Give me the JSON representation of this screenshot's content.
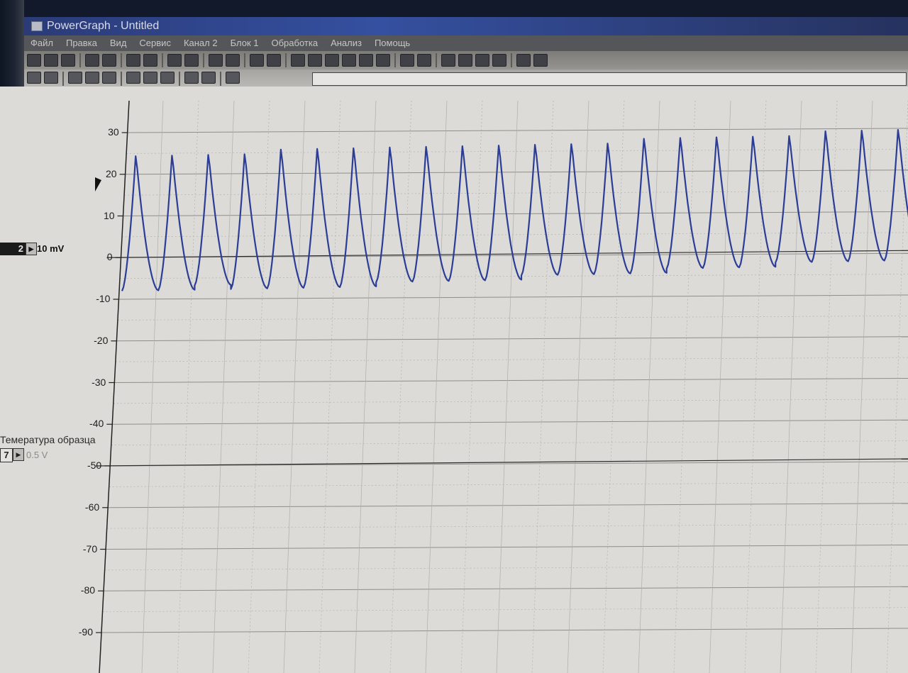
{
  "window": {
    "title": "PowerGraph - Untitled"
  },
  "menu": [
    "Файл",
    "Правка",
    "Вид",
    "Сервис",
    "Канал 2",
    "Блок 1",
    "Обработка",
    "Анализ",
    "Помощь"
  ],
  "toolbar1_icons": [
    "new-icon",
    "open-icon",
    "open-folder-icon",
    "save-icon",
    "save-as-icon",
    "print-icon",
    "print-preview-icon",
    "copy-block-icon",
    "paste-block-icon",
    "export-icon",
    "import-icon",
    "properties-icon",
    "record-icon",
    "channels-icon",
    "block-icon",
    "ruler-icon",
    "edit-data-icon",
    "merge-icon",
    "cut-block-icon",
    "function-icon",
    "table-icon",
    "zoom-analysis-icon",
    "histogram-icon",
    "spectrum-icon",
    "filter-icon",
    "help-icon",
    "web-icon"
  ],
  "toolbar2_icons": [
    "channel-select-icon",
    "dropdown-icon",
    "scale-icon",
    "zoom-out-icon",
    "zoom-in-icon",
    "vertical-fit-icon",
    "horizontal-fit-icon",
    "grid-icon",
    "autoscale-icon",
    "auto-range-icon",
    "marker-icon"
  ],
  "channels": {
    "ch2": {
      "number": "2",
      "range": "10 mV"
    },
    "ch7": {
      "name": "Темература образца",
      "number": "7",
      "range": "0.5 V"
    }
  },
  "y_axis_ticks": [
    "30",
    "20",
    "10",
    "0",
    "-10",
    "-20",
    "-30",
    "-40",
    "-50",
    "-60",
    "-70",
    "-80",
    "-90"
  ],
  "chart_data": {
    "type": "line",
    "series": [
      {
        "color": "#2b3d96",
        "description_values": "periodic oscillation, 22 cycles, peaks",
        "peaks": [
          25,
          25,
          25,
          25,
          26,
          26,
          26,
          26,
          26,
          26,
          26,
          26,
          26,
          26,
          27,
          27,
          27,
          27,
          27,
          28,
          28,
          28
        ],
        "troughs": [
          -8,
          -8,
          -7,
          -8,
          -8,
          -8,
          -8,
          -7,
          -7,
          -7,
          -7,
          -6,
          -6,
          -6,
          -6,
          -5,
          -5,
          -5,
          -4,
          -4,
          -4,
          -4
        ]
      }
    ],
    "ylim": [
      -90,
      30
    ],
    "grid": true,
    "colors": {
      "trace": "#2b3d96",
      "grid": "#9c9b97",
      "background": "#dcdbd7"
    }
  }
}
